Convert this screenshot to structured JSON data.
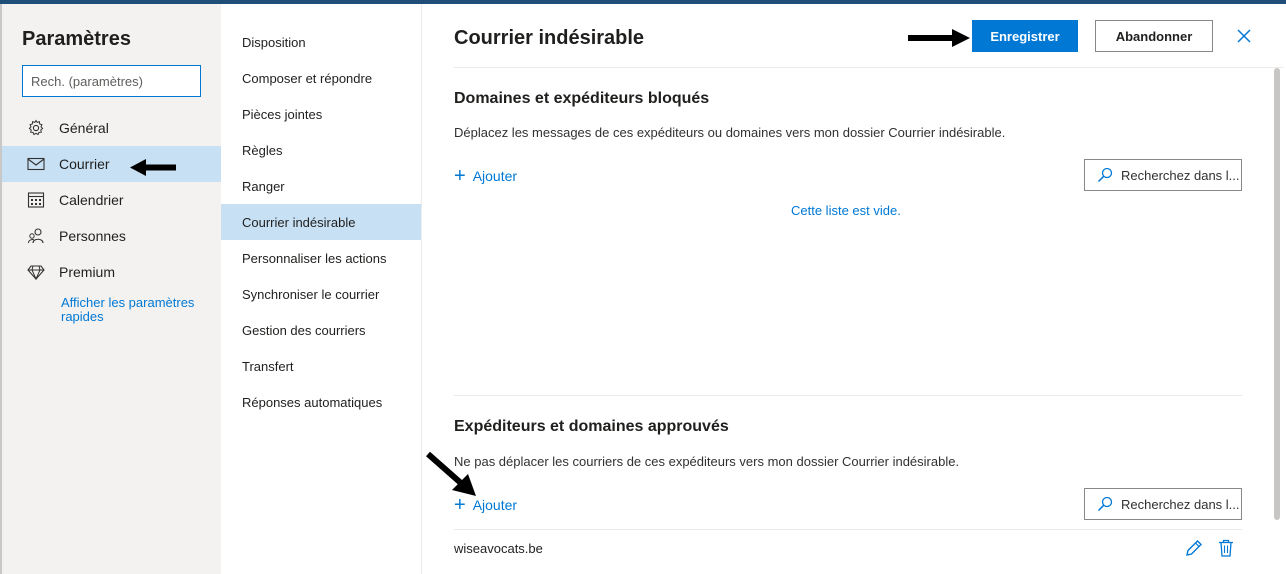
{
  "sidebar": {
    "title": "Paramètres",
    "search_placeholder": "Rech. (paramètres)",
    "items": [
      {
        "label": "Général",
        "icon": "gear-icon",
        "selected": false
      },
      {
        "label": "Courrier",
        "icon": "mail-icon",
        "selected": true
      },
      {
        "label": "Calendrier",
        "icon": "calendar-icon",
        "selected": false
      },
      {
        "label": "Personnes",
        "icon": "people-icon",
        "selected": false
      },
      {
        "label": "Premium",
        "icon": "diamond-icon",
        "selected": false
      }
    ],
    "quick_settings_link": "Afficher les paramètres rapides"
  },
  "subnav": {
    "items": [
      {
        "label": "Disposition",
        "selected": false
      },
      {
        "label": "Composer et répondre",
        "selected": false
      },
      {
        "label": "Pièces jointes",
        "selected": false
      },
      {
        "label": "Règles",
        "selected": false
      },
      {
        "label": "Ranger",
        "selected": false
      },
      {
        "label": "Courrier indésirable",
        "selected": true
      },
      {
        "label": "Personnaliser les actions",
        "selected": false
      },
      {
        "label": "Synchroniser le courrier",
        "selected": false
      },
      {
        "label": "Gestion des courriers",
        "selected": false
      },
      {
        "label": "Transfert",
        "selected": false
      },
      {
        "label": "Réponses automatiques",
        "selected": false
      }
    ]
  },
  "pane": {
    "title": "Courrier indésirable",
    "save_label": "Enregistrer",
    "discard_label": "Abandonner",
    "blocked": {
      "title": "Domaines et expéditeurs bloqués",
      "description": "Déplacez les messages de ces expéditeurs ou domaines vers mon dossier Courrier indésirable.",
      "add_label": "Ajouter",
      "search_placeholder": "Recherchez dans l...",
      "empty_message": "Cette liste est vide."
    },
    "safe": {
      "title": "Expéditeurs et domaines approuvés",
      "description": "Ne pas déplacer les courriers de ces expéditeurs vers mon dossier Courrier indésirable.",
      "add_label": "Ajouter",
      "search_placeholder": "Recherchez dans l...",
      "entries": [
        "wiseavocats.be"
      ]
    }
  },
  "colors": {
    "accent": "#0078d4",
    "selected_bg": "#c7e0f4",
    "sidebar_bg": "#f3f2f1",
    "annotation_arrow": "#000000"
  }
}
